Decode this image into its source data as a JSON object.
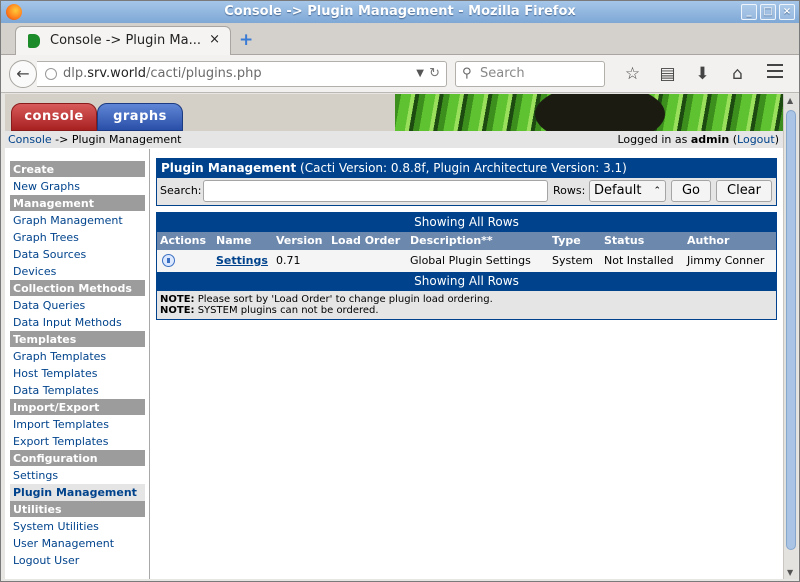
{
  "window": {
    "title": "Console -> Plugin Management - Mozilla Firefox"
  },
  "tab": {
    "title": "Console -> Plugin Ma...",
    "close": "×",
    "new": "+"
  },
  "urlbar": {
    "host_prefix": "dlp.",
    "host_domain": "srv.world",
    "path": "/cacti/plugins.php"
  },
  "search": {
    "placeholder": "Search"
  },
  "banner": {
    "console_tab": "console",
    "graphs_tab": "graphs"
  },
  "breadcrumb": {
    "home": "Console",
    "current": " -> Plugin Management"
  },
  "login": {
    "prefix": "Logged in as ",
    "user": "admin",
    "logout": "Logout"
  },
  "sidebar": [
    {
      "type": "head",
      "label": "Create"
    },
    {
      "type": "item",
      "label": "New Graphs"
    },
    {
      "type": "head",
      "label": "Management"
    },
    {
      "type": "item",
      "label": "Graph Management"
    },
    {
      "type": "item",
      "label": "Graph Trees"
    },
    {
      "type": "item",
      "label": "Data Sources"
    },
    {
      "type": "item",
      "label": "Devices"
    },
    {
      "type": "head",
      "label": "Collection Methods"
    },
    {
      "type": "item",
      "label": "Data Queries"
    },
    {
      "type": "item",
      "label": "Data Input Methods"
    },
    {
      "type": "head",
      "label": "Templates"
    },
    {
      "type": "item",
      "label": "Graph Templates"
    },
    {
      "type": "item",
      "label": "Host Templates"
    },
    {
      "type": "item",
      "label": "Data Templates"
    },
    {
      "type": "head",
      "label": "Import/Export"
    },
    {
      "type": "item",
      "label": "Import Templates"
    },
    {
      "type": "item",
      "label": "Export Templates"
    },
    {
      "type": "head",
      "label": "Configuration"
    },
    {
      "type": "item",
      "label": "Settings"
    },
    {
      "type": "item",
      "label": "Plugin Management",
      "active": true
    },
    {
      "type": "head",
      "label": "Utilities"
    },
    {
      "type": "item",
      "label": "System Utilities"
    },
    {
      "type": "item",
      "label": "User Management"
    },
    {
      "type": "item",
      "label": "Logout User"
    }
  ],
  "panel": {
    "title": "Plugin Management",
    "subtitle": " (Cacti Version: 0.8.8f, Plugin Architecture Version: 3.1)",
    "search_label": "Search:",
    "search_value": "",
    "rows_label": "Rows:",
    "rows_value": "Default",
    "go": "Go",
    "clear": "Clear"
  },
  "table": {
    "rows_banner": "Showing All Rows",
    "headers": [
      "Actions",
      "Name",
      "Version",
      "Load Order",
      "Description**",
      "Type",
      "Status",
      "Author"
    ],
    "rows": [
      {
        "name": "Settings",
        "version": "0.71",
        "load_order": "",
        "description": "Global Plugin Settings",
        "type": "System",
        "status": "Not Installed",
        "author": "Jimmy Conner"
      }
    ],
    "notes": [
      {
        "label": "NOTE:",
        "text": " Please sort by 'Load Order' to change plugin load ordering."
      },
      {
        "label": "NOTE:",
        "text": " SYSTEM plugins can not be ordered."
      }
    ]
  },
  "colors": {
    "header_blue": "#00438c",
    "sidebar_head": "#9c9c9c",
    "column_head": "#6d88ad"
  }
}
